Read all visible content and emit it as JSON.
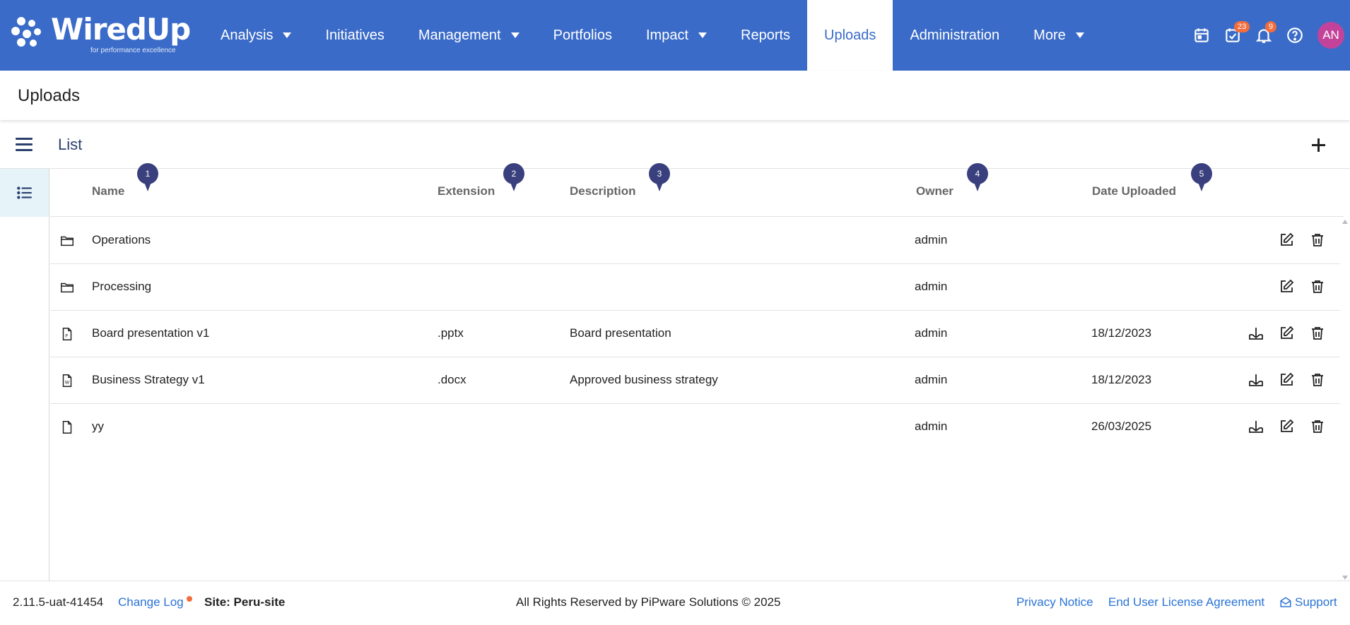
{
  "app": {
    "logo_text": "WiredUp",
    "logo_tagline": "for performance excellence"
  },
  "nav": {
    "items": [
      {
        "label": "Analysis",
        "dropdown": true
      },
      {
        "label": "Initiatives",
        "dropdown": false
      },
      {
        "label": "Management",
        "dropdown": true
      },
      {
        "label": "Portfolios",
        "dropdown": false
      },
      {
        "label": "Impact",
        "dropdown": true
      },
      {
        "label": "Reports",
        "dropdown": false
      },
      {
        "label": "Uploads",
        "dropdown": false,
        "active": true
      },
      {
        "label": "Administration",
        "dropdown": false
      },
      {
        "label": "More",
        "dropdown": true
      }
    ],
    "icons": {
      "calendar": "calendar-icon",
      "tasks": "tasks-icon",
      "tasks_badge": "23",
      "notifications": "bell-icon",
      "notifications_badge": "9",
      "help": "help-icon"
    },
    "avatar_initials": "AN"
  },
  "page": {
    "title": "Uploads"
  },
  "toolbar": {
    "label": "List"
  },
  "table": {
    "columns": [
      {
        "label": "Name",
        "pin": "1"
      },
      {
        "label": "Extension",
        "pin": "2"
      },
      {
        "label": "Description",
        "pin": "3"
      },
      {
        "label": "Owner",
        "pin": "4"
      },
      {
        "label": "Date Uploaded",
        "pin": "5"
      }
    ],
    "rows": [
      {
        "type": "folder",
        "name": "Operations",
        "extension": "",
        "description": "",
        "owner": "admin",
        "date": "",
        "download": false
      },
      {
        "type": "folder",
        "name": "Processing",
        "extension": "",
        "description": "",
        "owner": "admin",
        "date": "",
        "download": false
      },
      {
        "type": "pptx",
        "name": "Board presentation v1",
        "extension": ".pptx",
        "description": "Board presentation",
        "owner": "admin",
        "date": "18/12/2023",
        "download": true
      },
      {
        "type": "docx",
        "name": "Business Strategy v1",
        "extension": ".docx",
        "description": "Approved business strategy",
        "owner": "admin",
        "date": "18/12/2023",
        "download": true
      },
      {
        "type": "file",
        "name": "yy",
        "extension": "",
        "description": "",
        "owner": "admin",
        "date": "26/03/2025",
        "download": true
      }
    ]
  },
  "footer": {
    "version": "2.11.5-uat-41454",
    "changelog": "Change Log",
    "site": "Site: Peru-site",
    "copyright": "All Rights Reserved by PiPware Solutions © 2025",
    "privacy": "Privacy Notice",
    "eula": "End User License Agreement",
    "support": "Support"
  },
  "colors": {
    "nav_bg": "#3a6bc8",
    "pin": "#39407d",
    "badge": "#f26d3d",
    "avatar": "#c3439a",
    "link": "#2a73d6"
  }
}
